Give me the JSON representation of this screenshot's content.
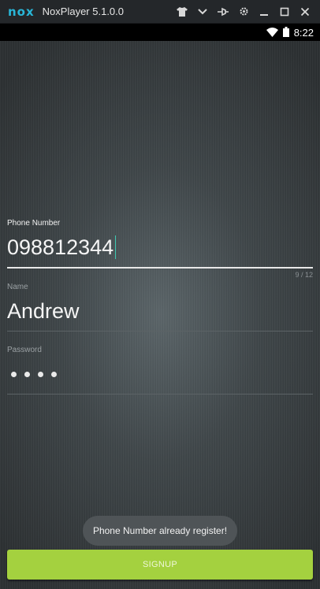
{
  "emulator": {
    "logo": "nox",
    "title": "NoxPlayer 5.1.0.0",
    "controls": [
      "shirt-icon",
      "chevron-down-icon",
      "pin-icon",
      "gear-icon",
      "minimize-icon",
      "maximize-icon",
      "close-icon"
    ]
  },
  "statusbar": {
    "time": "8:22"
  },
  "form": {
    "phone": {
      "label": "Phone Number",
      "value": "098812344",
      "counter": "9 / 12"
    },
    "name": {
      "label": "Name",
      "value": "Andrew"
    },
    "password": {
      "label": "Password",
      "masked_length": 4
    }
  },
  "toast": {
    "message": "Phone Number already register!"
  },
  "signup_button": {
    "label": "SIGNUP"
  },
  "colors": {
    "accent": "#a4d13f",
    "cursor": "#3ec7b0",
    "nox_brand": "#29b6d8"
  }
}
